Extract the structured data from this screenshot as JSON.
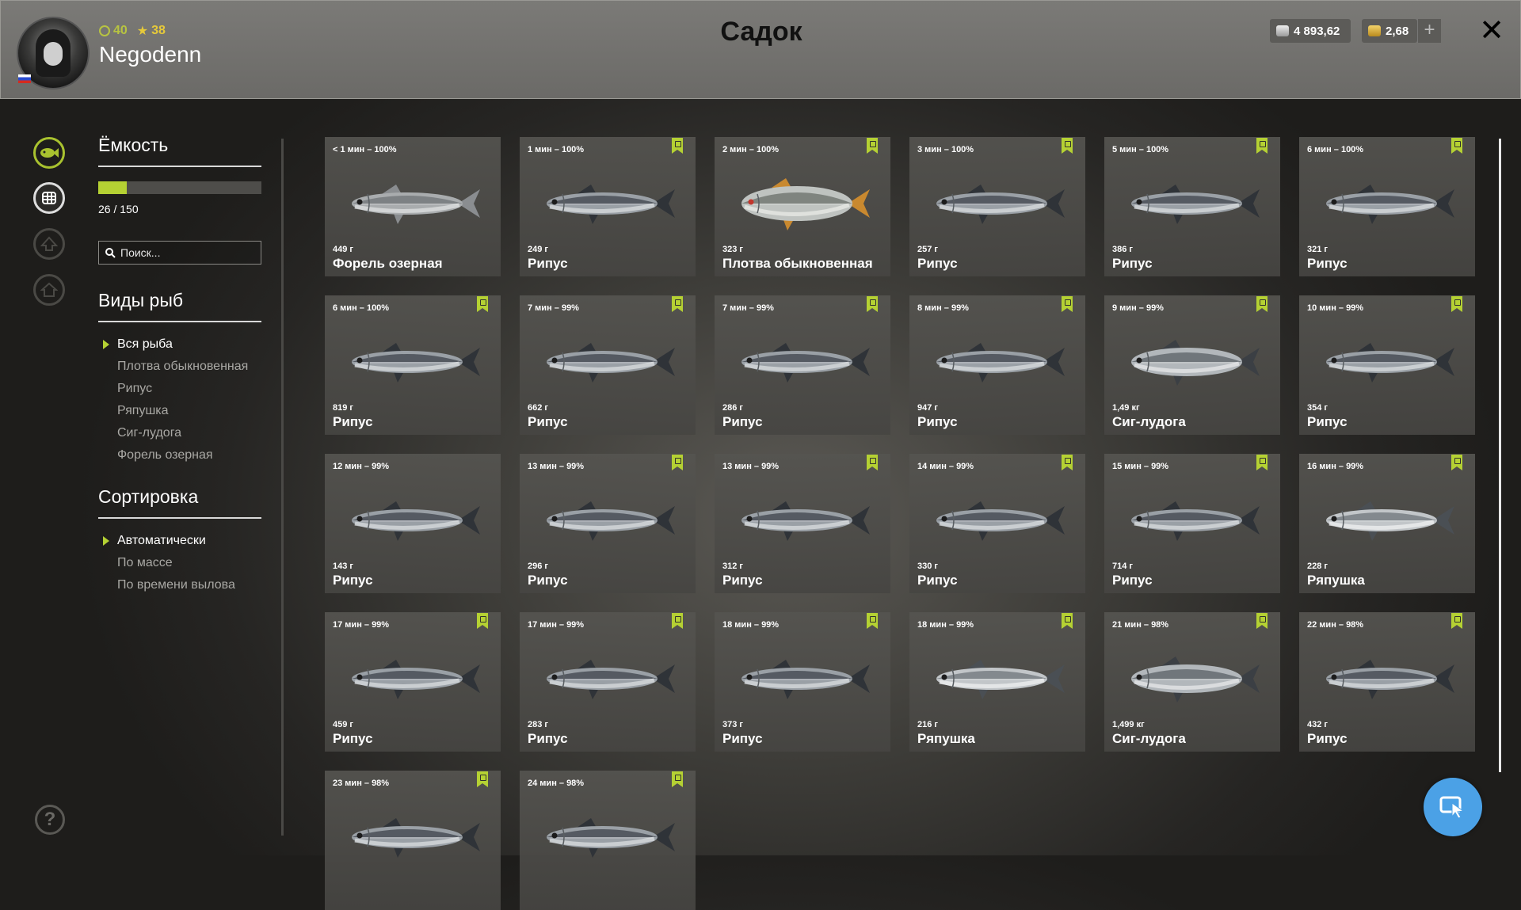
{
  "header": {
    "title": "Садок",
    "username": "Negodenn",
    "level": "40",
    "rank": "38",
    "silver": "4 893,62",
    "gold": "2,68",
    "plus_label": "+",
    "close_label": "✕",
    "flag_icon": "russia-flag-icon"
  },
  "sidebar": {
    "capacity_title": "Ёмкость",
    "capacity_count": "26 / 150",
    "capacity_fraction": 0.1733,
    "search_placeholder": "Поиск...",
    "species_title": "Виды рыб",
    "species": [
      "Вся рыба",
      "Плотва обыкновенная",
      "Рипус",
      "Ряпушка",
      "Сиг-лудога",
      "Форель озерная"
    ],
    "species_active": 0,
    "sorting_title": "Сортировка",
    "sorting": [
      "Автоматически",
      "По массе",
      "По времени вылова"
    ],
    "sorting_active": 0,
    "nav_icons": [
      "fish-icon",
      "keepnet-icon",
      "upgrade-icon",
      "home-icon"
    ],
    "help_label": "?"
  },
  "colors": {
    "accent": "#b5d133",
    "fab": "#4ba1e6"
  },
  "fish": [
    {
      "time": "< 1 мин – 100%",
      "weight": "449 г",
      "name": "Форель озерная",
      "bookmarked": false,
      "kind": "trout"
    },
    {
      "time": "1 мин – 100%",
      "weight": "249 г",
      "name": "Рипус",
      "bookmarked": true,
      "kind": "ripus"
    },
    {
      "time": "2 мин – 100%",
      "weight": "323 г",
      "name": "Плотва обыкновенная",
      "bookmarked": true,
      "kind": "roach"
    },
    {
      "time": "3 мин – 100%",
      "weight": "257 г",
      "name": "Рипус",
      "bookmarked": true,
      "kind": "ripus"
    },
    {
      "time": "5 мин – 100%",
      "weight": "386 г",
      "name": "Рипус",
      "bookmarked": true,
      "kind": "ripus"
    },
    {
      "time": "6 мин – 100%",
      "weight": "321 г",
      "name": "Рипус",
      "bookmarked": true,
      "kind": "ripus"
    },
    {
      "time": "6 мин – 100%",
      "weight": "819 г",
      "name": "Рипус",
      "bookmarked": true,
      "kind": "ripus"
    },
    {
      "time": "7 мин – 99%",
      "weight": "662 г",
      "name": "Рипус",
      "bookmarked": true,
      "kind": "ripus"
    },
    {
      "time": "7 мин – 99%",
      "weight": "286 г",
      "name": "Рипус",
      "bookmarked": true,
      "kind": "ripus"
    },
    {
      "time": "8 мин – 99%",
      "weight": "947 г",
      "name": "Рипус",
      "bookmarked": true,
      "kind": "ripus"
    },
    {
      "time": "9 мин – 99%",
      "weight": "1,49 кг",
      "name": "Сиг-лудога",
      "bookmarked": true,
      "kind": "sig"
    },
    {
      "time": "10 мин – 99%",
      "weight": "354 г",
      "name": "Рипус",
      "bookmarked": true,
      "kind": "ripus"
    },
    {
      "time": "12 мин – 99%",
      "weight": "143 г",
      "name": "Рипус",
      "bookmarked": false,
      "kind": "ripus"
    },
    {
      "time": "13 мин – 99%",
      "weight": "296 г",
      "name": "Рипус",
      "bookmarked": true,
      "kind": "ripus"
    },
    {
      "time": "13 мин – 99%",
      "weight": "312 г",
      "name": "Рипус",
      "bookmarked": true,
      "kind": "ripus"
    },
    {
      "time": "14 мин – 99%",
      "weight": "330 г",
      "name": "Рипус",
      "bookmarked": true,
      "kind": "ripus"
    },
    {
      "time": "15 мин – 99%",
      "weight": "714 г",
      "name": "Рипус",
      "bookmarked": true,
      "kind": "ripus"
    },
    {
      "time": "16 мин – 99%",
      "weight": "228 г",
      "name": "Ряпушка",
      "bookmarked": true,
      "kind": "vendace"
    },
    {
      "time": "17 мин – 99%",
      "weight": "459 г",
      "name": "Рипус",
      "bookmarked": true,
      "kind": "ripus"
    },
    {
      "time": "17 мин – 99%",
      "weight": "283 г",
      "name": "Рипус",
      "bookmarked": true,
      "kind": "ripus"
    },
    {
      "time": "18 мин – 99%",
      "weight": "373 г",
      "name": "Рипус",
      "bookmarked": true,
      "kind": "ripus"
    },
    {
      "time": "18 мин – 99%",
      "weight": "216 г",
      "name": "Ряпушка",
      "bookmarked": true,
      "kind": "vendace"
    },
    {
      "time": "21 мин – 98%",
      "weight": "1,499 кг",
      "name": "Сиг-лудога",
      "bookmarked": true,
      "kind": "sig"
    },
    {
      "time": "22 мин – 98%",
      "weight": "432 г",
      "name": "Рипус",
      "bookmarked": true,
      "kind": "ripus"
    },
    {
      "time": "23 мин – 98%",
      "weight": "",
      "name": "",
      "bookmarked": true,
      "kind": "ripus"
    },
    {
      "time": "24 мин – 98%",
      "weight": "",
      "name": "",
      "bookmarked": true,
      "kind": "ripus"
    }
  ]
}
